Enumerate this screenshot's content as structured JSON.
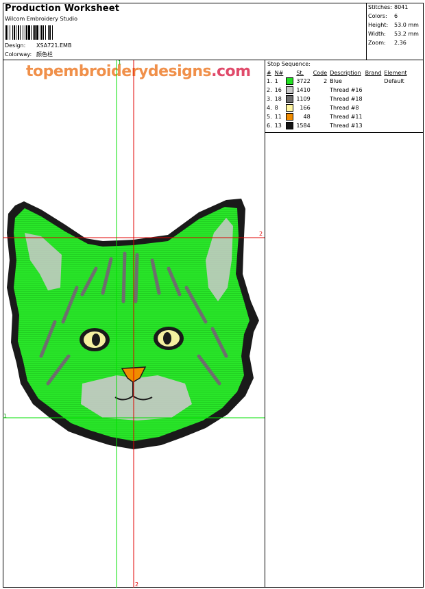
{
  "header": {
    "title": "Production Worksheet",
    "software": "Wilcom  Embroidery Studio",
    "design_label": "Design:",
    "design_value": "XSA721.EMB",
    "colorway_label": "Colorway:",
    "colorway_value": "颜色栏"
  },
  "stats": [
    {
      "label": "Stitches:",
      "value": "8041"
    },
    {
      "label": "Colors:",
      "value": "6"
    },
    {
      "label": "Height:",
      "value": "53.0 mm"
    },
    {
      "label": "Width:",
      "value": "53.2 mm"
    },
    {
      "label": "Zoom:",
      "value": "2.36"
    }
  ],
  "stop_sequence": {
    "title": "Stop Sequence:",
    "headers": [
      "#",
      "N#",
      "St.",
      "Code",
      "Description",
      "Brand",
      "Element"
    ],
    "rows": [
      {
        "index": "1.",
        "n": "1",
        "color": "#22e022",
        "stitches": "3722",
        "code": "2",
        "description": "Blue",
        "brand": "",
        "element": "Default"
      },
      {
        "index": "2.",
        "n": "16",
        "color": "#c8c8c8",
        "stitches": "1410",
        "code": "",
        "description": "Thread #16",
        "brand": "",
        "element": ""
      },
      {
        "index": "3.",
        "n": "18",
        "color": "#6e6e6e",
        "stitches": "1109",
        "code": "",
        "description": "Thread #18",
        "brand": "",
        "element": ""
      },
      {
        "index": "4.",
        "n": "8",
        "color": "#fff5a0",
        "stitches": "166",
        "code": "",
        "description": "Thread #8",
        "brand": "",
        "element": ""
      },
      {
        "index": "5.",
        "n": "11",
        "color": "#f08c00",
        "stitches": "48",
        "code": "",
        "description": "Thread #11",
        "brand": "",
        "element": ""
      },
      {
        "index": "6.",
        "n": "13",
        "color": "#141414",
        "stitches": "1584",
        "code": "",
        "description": "Thread #13",
        "brand": "",
        "element": ""
      }
    ]
  },
  "watermark": {
    "main": "topembroiderydesigns",
    "suffix": ".com"
  },
  "guides": {
    "marker_1": "1",
    "marker_2": "2"
  }
}
